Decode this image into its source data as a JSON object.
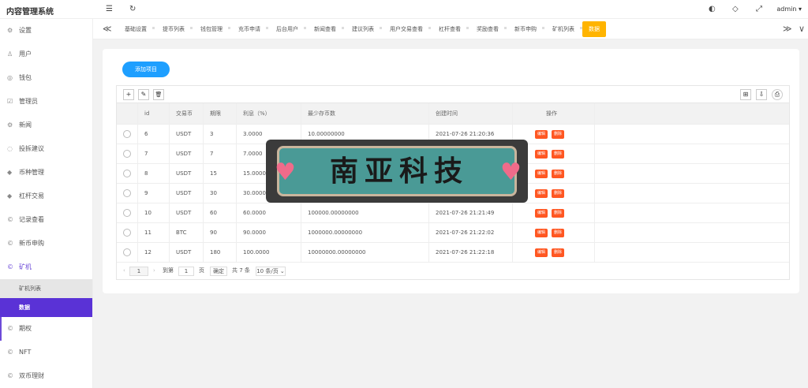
{
  "header": {
    "app_title": "内容管理系统",
    "user": "admin ▾",
    "icons": {
      "menu": "☰",
      "refresh": "↻",
      "theme": "◐",
      "tag": "◇",
      "fullscreen": "⤢"
    }
  },
  "sidebar": {
    "items": [
      {
        "label": "设置",
        "icon": "⚙"
      },
      {
        "label": "用户",
        "icon": "♙"
      },
      {
        "label": "钱包",
        "icon": "◎"
      },
      {
        "label": "管理员",
        "icon": "☑"
      },
      {
        "label": "新闻",
        "icon": "⚙"
      },
      {
        "label": "投拆建议",
        "icon": "◌"
      },
      {
        "label": "币种管理",
        "icon": "◆"
      },
      {
        "label": "杠杆交易",
        "icon": "◆"
      },
      {
        "label": "记录查看",
        "icon": "©"
      },
      {
        "label": "新币申购",
        "icon": "©"
      },
      {
        "label": "矿机",
        "icon": "©"
      }
    ],
    "sub_items": [
      {
        "label": "矿机列表"
      },
      {
        "label": "数据"
      }
    ],
    "bottom_items": [
      {
        "label": "期权",
        "icon": "©"
      },
      {
        "label": "NFT",
        "icon": "©"
      },
      {
        "label": "双币理财",
        "icon": "©"
      }
    ]
  },
  "tabbar": {
    "left_arrow": "≪",
    "right_arrow": "≫",
    "right_caret": "∨",
    "tabs": [
      {
        "label": "基础设置"
      },
      {
        "label": "提币列表"
      },
      {
        "label": "钱包管理"
      },
      {
        "label": "充币申请"
      },
      {
        "label": "后台用户"
      },
      {
        "label": "新闻查看"
      },
      {
        "label": "建议列表"
      },
      {
        "label": "用户交易查看"
      },
      {
        "label": "杠杆查看"
      },
      {
        "label": "奖励查看"
      },
      {
        "label": "新币申购"
      },
      {
        "label": "矿机列表"
      },
      {
        "label": "数据"
      }
    ]
  },
  "main": {
    "add_button": "添加项目",
    "toolbar": {
      "add": "+",
      "edit": "✎",
      "delete": "🗑",
      "columns": "⊞",
      "export": "⇩",
      "print": "⎙"
    },
    "columns": [
      "id",
      "交易币",
      "期限",
      "利息（%）",
      "最少存币数",
      "创建时间",
      "操作"
    ],
    "rows": [
      {
        "id": "6",
        "coin": "USDT",
        "term": "3",
        "interest": "3.0000",
        "min": "10.00000000",
        "created": "2021-07-26 21:20:36"
      },
      {
        "id": "7",
        "coin": "USDT",
        "term": "7",
        "interest": "7.0000",
        "min": "",
        "created": ""
      },
      {
        "id": "8",
        "coin": "USDT",
        "term": "15",
        "interest": "15.0000",
        "min": "",
        "created": ""
      },
      {
        "id": "9",
        "coin": "USDT",
        "term": "30",
        "interest": "30.0000",
        "min": "",
        "created": ""
      },
      {
        "id": "10",
        "coin": "USDT",
        "term": "60",
        "interest": "60.0000",
        "min": "100000.00000000",
        "created": "2021-07-26 21:21:49"
      },
      {
        "id": "11",
        "coin": "BTC",
        "term": "90",
        "interest": "90.0000",
        "min": "1000000.00000000",
        "created": "2021-07-26 21:22:02"
      },
      {
        "id": "12",
        "coin": "USDT",
        "term": "180",
        "interest": "100.0000",
        "min": "10000000.00000000",
        "created": "2021-07-26 21:22:18"
      }
    ],
    "op_edit": "编辑",
    "op_delete": "删除",
    "pager": {
      "prev": "‹",
      "current": "1",
      "next": "›",
      "goto_label": "到第",
      "goto_value": "1",
      "page_unit": "页",
      "confirm": "确定",
      "total": "共 7 条",
      "per_page": "10 条/页 ⌄"
    }
  },
  "watermark": {
    "text": "南亚科技",
    "heart": "♥"
  },
  "colors": {
    "accent": "#5a32d6",
    "primary_button": "#1e9fff",
    "active_tab": "#ffb400",
    "danger": "#ff5722"
  }
}
